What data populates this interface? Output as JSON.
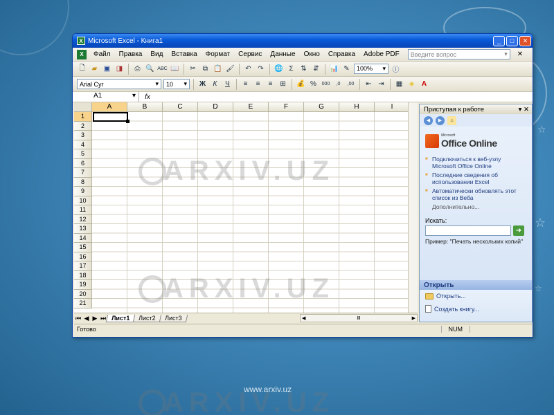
{
  "window": {
    "title": "Microsoft Excel - Книга1",
    "controls": [
      "_",
      "□",
      "✕"
    ]
  },
  "menubar": {
    "items": [
      "Файл",
      "Правка",
      "Вид",
      "Вставка",
      "Формат",
      "Сервис",
      "Данные",
      "Окно",
      "Справка",
      "Adobe PDF"
    ],
    "ask_placeholder": "Введите вопрос"
  },
  "toolbar_standard": {
    "zoom": "100%"
  },
  "toolbar_formatting": {
    "font": "Arial Cyr",
    "size": "10",
    "bold": "Ж",
    "italic": "К",
    "underline": "Ч",
    "percent": "%",
    "thousands": "000"
  },
  "formula_bar": {
    "name_box": "A1",
    "fx": "fx"
  },
  "grid": {
    "columns": [
      "A",
      "B",
      "C",
      "D",
      "E",
      "F",
      "G",
      "H",
      "I"
    ],
    "rows": [
      "1",
      "2",
      "3",
      "4",
      "5",
      "6",
      "7",
      "8",
      "9",
      "10",
      "11",
      "12",
      "13",
      "14",
      "15",
      "16",
      "17",
      "18",
      "19",
      "20",
      "21"
    ],
    "active_cell": "A1"
  },
  "sheets": {
    "tabs": [
      "Лист1",
      "Лист2",
      "Лист3"
    ],
    "active": "Лист1"
  },
  "statusbar": {
    "status": "Готово",
    "num": "NUM"
  },
  "taskpane": {
    "title": "Приступая к работе",
    "office_small": "Microsoft",
    "office_big": "Office Online",
    "links": [
      "Подключиться к веб-узлу Microsoft Office Online",
      "Последние сведения об использовании Excel",
      "Автоматически обновлять этот список из Веба"
    ],
    "more": "Дополнительно...",
    "search_label": "Искать:",
    "example": "Пример: \"Печать нескольких копий\"",
    "open_section": "Открыть",
    "open_link": "Открыть...",
    "create_link": "Создать книгу..."
  },
  "watermark": {
    "text": "ARXIV.UZ",
    "url": "www.arxiv.uz"
  },
  "colors": {
    "titlebar": "#0a5bd8",
    "background": "#3f86b8",
    "active_header": "#f8d38c"
  }
}
